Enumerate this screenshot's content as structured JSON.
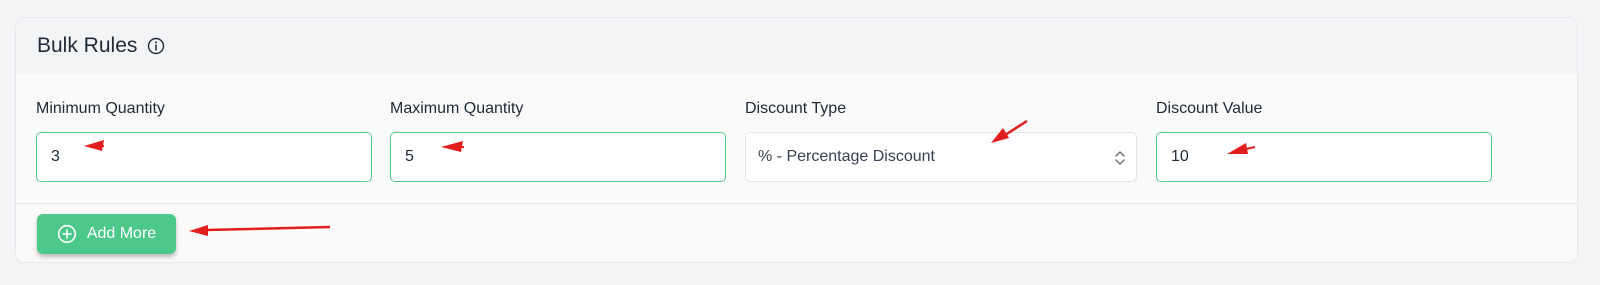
{
  "card": {
    "title": "Bulk Rules"
  },
  "fields": {
    "min_quantity": {
      "label": "Minimum Quantity",
      "value": "3"
    },
    "max_quantity": {
      "label": "Maximum Quantity",
      "value": "5"
    },
    "discount_type": {
      "label": "Discount Type",
      "selected": "% - Percentage Discount"
    },
    "discount_value": {
      "label": "Discount Value",
      "value": "10"
    }
  },
  "footer": {
    "add_more_label": "Add More"
  },
  "colors": {
    "accent": "#4cc88a",
    "input_border": "#56c98a",
    "annotation_arrow": "#e11d1d"
  },
  "icons": {
    "title_info": "info-icon",
    "add_button": "plus-circle-icon",
    "select_toggle": "chevron-up-down-icon"
  }
}
